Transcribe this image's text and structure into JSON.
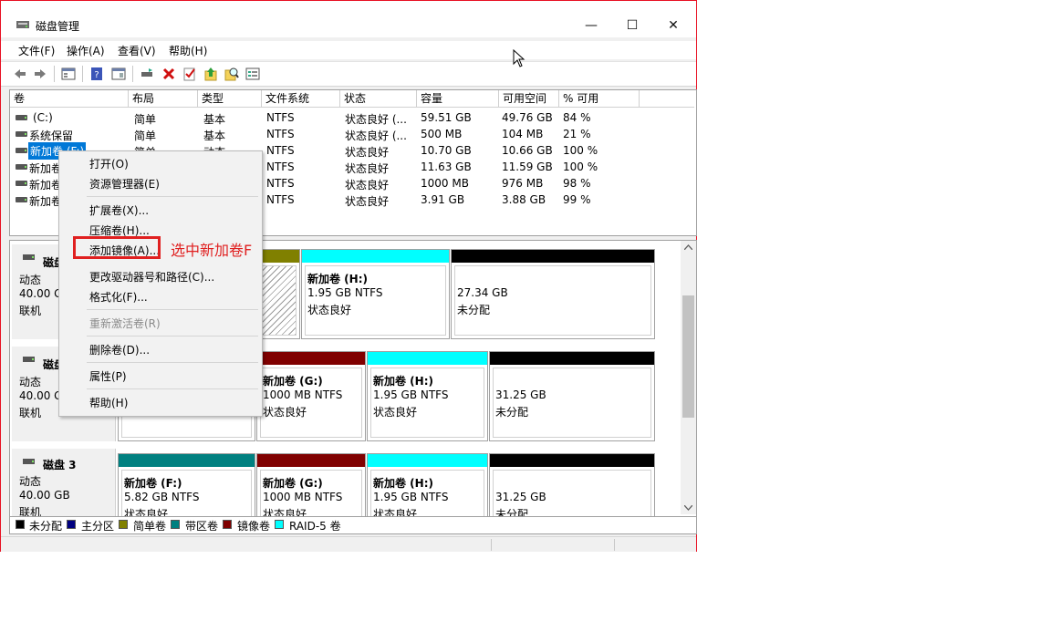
{
  "window": {
    "title": "磁盘管理"
  },
  "menubar": [
    "文件(F)",
    "操作(A)",
    "查看(V)",
    "帮助(H)"
  ],
  "toolbar_icons": [
    "back-icon",
    "forward-icon",
    "properties-icon",
    "help-icon",
    "console-icon",
    "connect-icon",
    "delete-icon",
    "check-icon",
    "up-icon",
    "search-icon",
    "list-icon"
  ],
  "volume_table": {
    "columns": [
      "卷",
      "布局",
      "类型",
      "文件系统",
      "状态",
      "容量",
      "可用空间",
      "% 可用"
    ],
    "rows": [
      [
        "(C:)",
        "简单",
        "基本",
        "NTFS",
        "状态良好 (...",
        "59.51 GB",
        "49.76 GB",
        "84 %"
      ],
      [
        "系统保留",
        "简单",
        "基本",
        "NTFS",
        "状态良好 (...",
        "500 MB",
        "104 MB",
        "21 %"
      ],
      [
        "新加卷 (F:)",
        "简单",
        "动态",
        "NTFS",
        "状态良好",
        "10.70 GB",
        "10.66 GB",
        "100 %"
      ],
      [
        "新加卷",
        "",
        "",
        "NTFS",
        "状态良好",
        "11.63 GB",
        "11.59 GB",
        "100 %"
      ],
      [
        "新加卷",
        "",
        "",
        "NTFS",
        "状态良好",
        "1000 MB",
        "976 MB",
        "98 %"
      ],
      [
        "新加卷",
        "",
        "",
        "NTFS",
        "状态良好",
        "3.91 GB",
        "3.88 GB",
        "99 %"
      ]
    ]
  },
  "disks": [
    {
      "name": "磁盘",
      "type": "动态",
      "size": "40.00 GB",
      "status": "联机",
      "parts": [
        {
          "name": "新加卷 (H:)",
          "size": "1.95 GB NTFS",
          "status": "状态良好",
          "color": "#00ffff"
        },
        {
          "name": "",
          "size": "27.34 GB",
          "status": "未分配",
          "color": "#000000"
        }
      ]
    },
    {
      "name": "磁盘",
      "type": "动态",
      "size": "40.00 GB",
      "status": "联机",
      "parts": [
        {
          "name": "新加卷 (G:)",
          "size": "1000 MB NTFS",
          "status": "状态良好",
          "color": "#800000"
        },
        {
          "name": "新加卷 (H:)",
          "size": "1.95 GB NTFS",
          "status": "状态良好",
          "color": "#00ffff"
        },
        {
          "name": "",
          "size": "31.25 GB",
          "status": "未分配",
          "color": "#000000"
        }
      ]
    },
    {
      "name": "磁盘 3",
      "type": "动态",
      "size": "40.00 GB",
      "status": "联机",
      "parts": [
        {
          "name": "新加卷 (F:)",
          "size": "5.82 GB NTFS",
          "status": "状态良好",
          "color": "#008080"
        },
        {
          "name": "新加卷 (G:)",
          "size": "1000 MB NTFS",
          "status": "状态良好",
          "color": "#800000"
        },
        {
          "name": "新加卷 (H:)",
          "size": "1.95 GB NTFS",
          "status": "状态良好",
          "color": "#00ffff"
        },
        {
          "name": "",
          "size": "31.25 GB",
          "status": "未分配",
          "color": "#000000"
        }
      ]
    }
  ],
  "legend": [
    {
      "label": "未分配",
      "color": "#000000"
    },
    {
      "label": "主分区",
      "color": "#000080"
    },
    {
      "label": "简单卷",
      "color": "#808000"
    },
    {
      "label": "带区卷",
      "color": "#008080"
    },
    {
      "label": "镜像卷",
      "color": "#800000"
    },
    {
      "label": "RAID-5 卷",
      "color": "#00ffff"
    }
  ],
  "context_menu": {
    "items": [
      "打开(O)",
      "资源管理器(E)",
      "扩展卷(X)...",
      "压缩卷(H)...",
      "添加镜像(A)...",
      "更改驱动器号和路径(C)...",
      "格式化(F)...",
      "重新激活卷(R)",
      "删除卷(D)...",
      "属性(P)",
      "帮助(H)"
    ]
  },
  "annotation": {
    "text": "选中新加卷F",
    "color": "#e02020"
  }
}
